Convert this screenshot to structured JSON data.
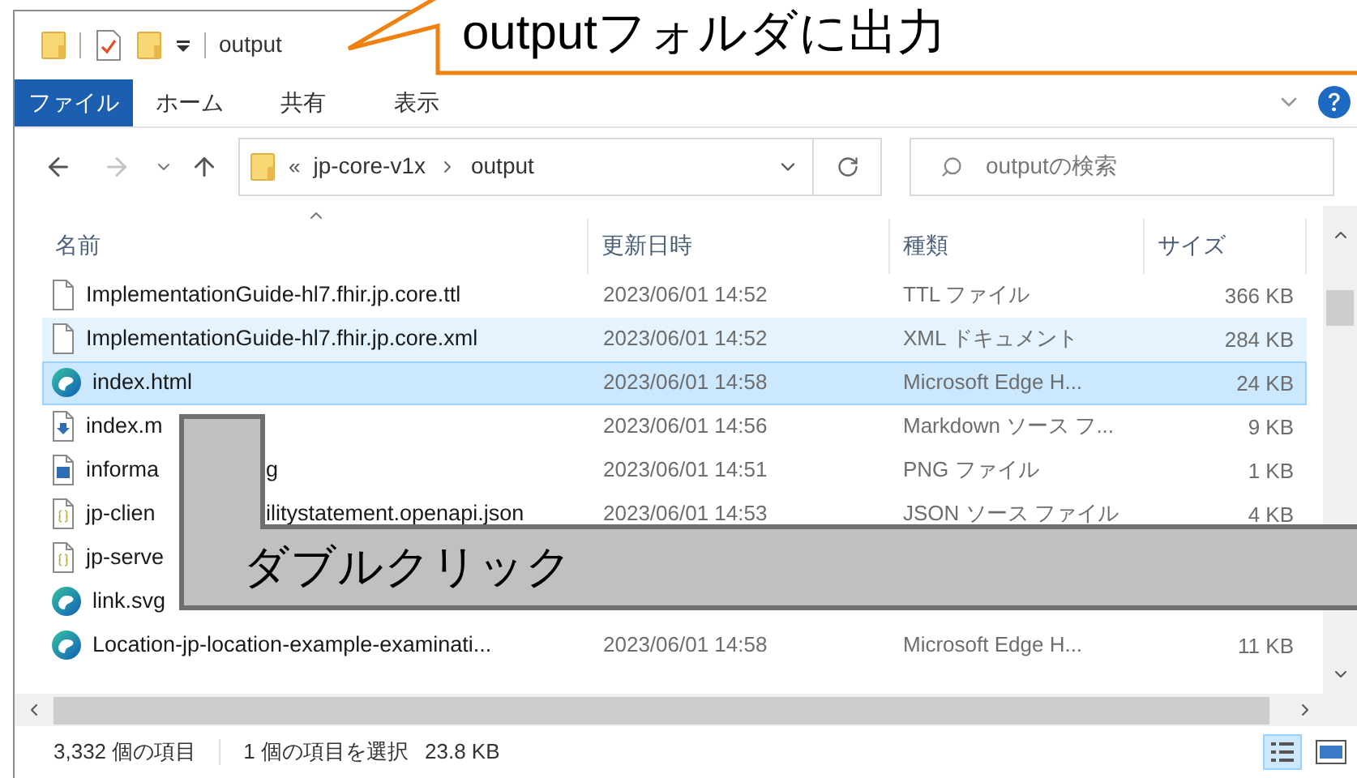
{
  "callouts": [
    {
      "kind": "title",
      "text": "outputフォルダに出力"
    },
    {
      "kind": "action",
      "text": "ダブルクリック"
    }
  ],
  "title_bar": {
    "title": "output"
  },
  "ribbon": {
    "tabs": [
      {
        "label": "ファイル",
        "kind": "file_menu"
      },
      {
        "label": "ホーム",
        "kind": "tab"
      },
      {
        "label": "共有",
        "kind": "tab"
      },
      {
        "label": "表示",
        "kind": "tab"
      }
    ]
  },
  "address_bar": {
    "overflow": "«",
    "path": [
      "jp-core-v1x",
      "output"
    ]
  },
  "search": {
    "placeholder": "outputの検索"
  },
  "file_list": {
    "columns": [
      {
        "label": "名前",
        "sorted": true
      },
      {
        "label": "更新日時",
        "sorted": false
      },
      {
        "label": "種類",
        "sorted": false
      },
      {
        "label": "サイズ",
        "sorted": false
      }
    ],
    "rows": [
      {
        "kind": "text",
        "name": "ImplementationGuide-hl7.fhir.jp.core.ttl",
        "modified": "2023/06/01 14:52",
        "type": "TTL ファイル",
        "size": "366 KB",
        "selected": false,
        "hovered": false
      },
      {
        "kind": "text",
        "name": "ImplementationGuide-hl7.fhir.jp.core.xml",
        "modified": "2023/06/01 14:52",
        "type": "XML ドキュメント",
        "size": "284 KB",
        "selected": false,
        "hovered": true
      },
      {
        "kind": "edge",
        "name": "index.html",
        "modified": "2023/06/01 14:58",
        "type": "Microsoft Edge H...",
        "size": "24 KB",
        "selected": true,
        "hovered": false
      },
      {
        "kind": "markdown",
        "name": "index.m",
        "modified": "2023/06/01 14:56",
        "type": "Markdown ソース フ...",
        "size": "9 KB",
        "selected": false,
        "hovered": false
      },
      {
        "kind": "image",
        "name": "informa",
        "name_tail": "g",
        "modified": "2023/06/01 14:51",
        "type": "PNG ファイル",
        "size": "1 KB",
        "selected": false,
        "hovered": false
      },
      {
        "kind": "json",
        "name": "jp-clien",
        "name_tail": "ilitystatement.openapi.json",
        "modified": "2023/06/01 14:53",
        "type": "JSON ソース ファイル",
        "size": "4 KB",
        "selected": false,
        "hovered": false
      },
      {
        "kind": "json",
        "name": "jp-serve",
        "selected": false,
        "hovered": false
      },
      {
        "kind": "edge",
        "name": "link.svg",
        "selected": false,
        "hovered": false
      },
      {
        "kind": "edge",
        "name": "Location-jp-location-example-examinati...",
        "modified": "2023/06/01 14:58",
        "type": "Microsoft Edge H...",
        "size": "11 KB",
        "selected": false,
        "hovered": false
      }
    ]
  },
  "status_bar": {
    "item_count": "3,332 個の項目",
    "selection": "1 個の項目を選択",
    "selection_size": "23.8 KB"
  }
}
